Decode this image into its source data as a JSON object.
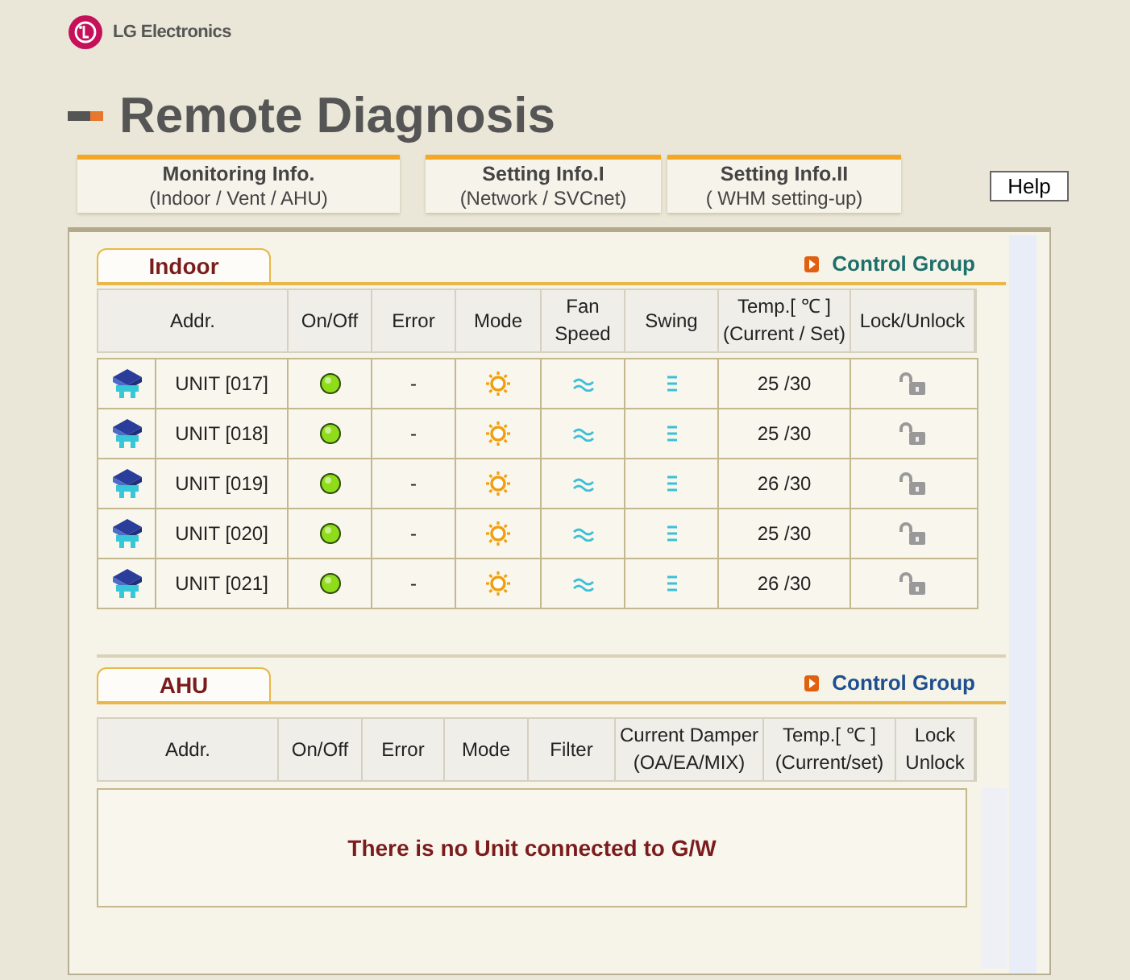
{
  "brand": "LG Electronics",
  "title": "Remote Diagnosis",
  "tabs": [
    {
      "title": "Monitoring Info.",
      "subtitle": "(Indoor / Vent / AHU)"
    },
    {
      "title": "Setting Info.I",
      "subtitle": "(Network / SVCnet)"
    },
    {
      "title": "Setting Info.II",
      "subtitle": "( WHM setting-up)"
    }
  ],
  "help_button": "Help",
  "indoor": {
    "tab": "Indoor",
    "control_group": "Control Group",
    "columns": [
      "Addr.",
      "On/Off",
      "Error",
      "Mode",
      "Fan Speed",
      "Swing",
      "Temp.[ ℃ ](Current / Set)",
      "Lock/Unlock"
    ],
    "rows": [
      {
        "addr": "UNIT [017]",
        "on": true,
        "error": "-",
        "temp": "25 /30",
        "locked": false
      },
      {
        "addr": "UNIT [018]",
        "on": true,
        "error": "-",
        "temp": "25 /30",
        "locked": false
      },
      {
        "addr": "UNIT [019]",
        "on": true,
        "error": "-",
        "temp": "26 /30",
        "locked": false
      },
      {
        "addr": "UNIT [020]",
        "on": true,
        "error": "-",
        "temp": "25 /30",
        "locked": false
      },
      {
        "addr": "UNIT [021]",
        "on": true,
        "error": "-",
        "temp": "26 /30",
        "locked": false
      }
    ]
  },
  "ahu": {
    "tab": "AHU",
    "control_group": "Control Group",
    "columns": [
      "Addr.",
      "On/Off",
      "Error",
      "Mode",
      "Filter",
      "Current Damper (OA/EA/MIX)",
      "Temp.[ ℃ ](Current/set)",
      "Lock Unlock"
    ],
    "empty_message": "There is no Unit connected to G/W"
  }
}
